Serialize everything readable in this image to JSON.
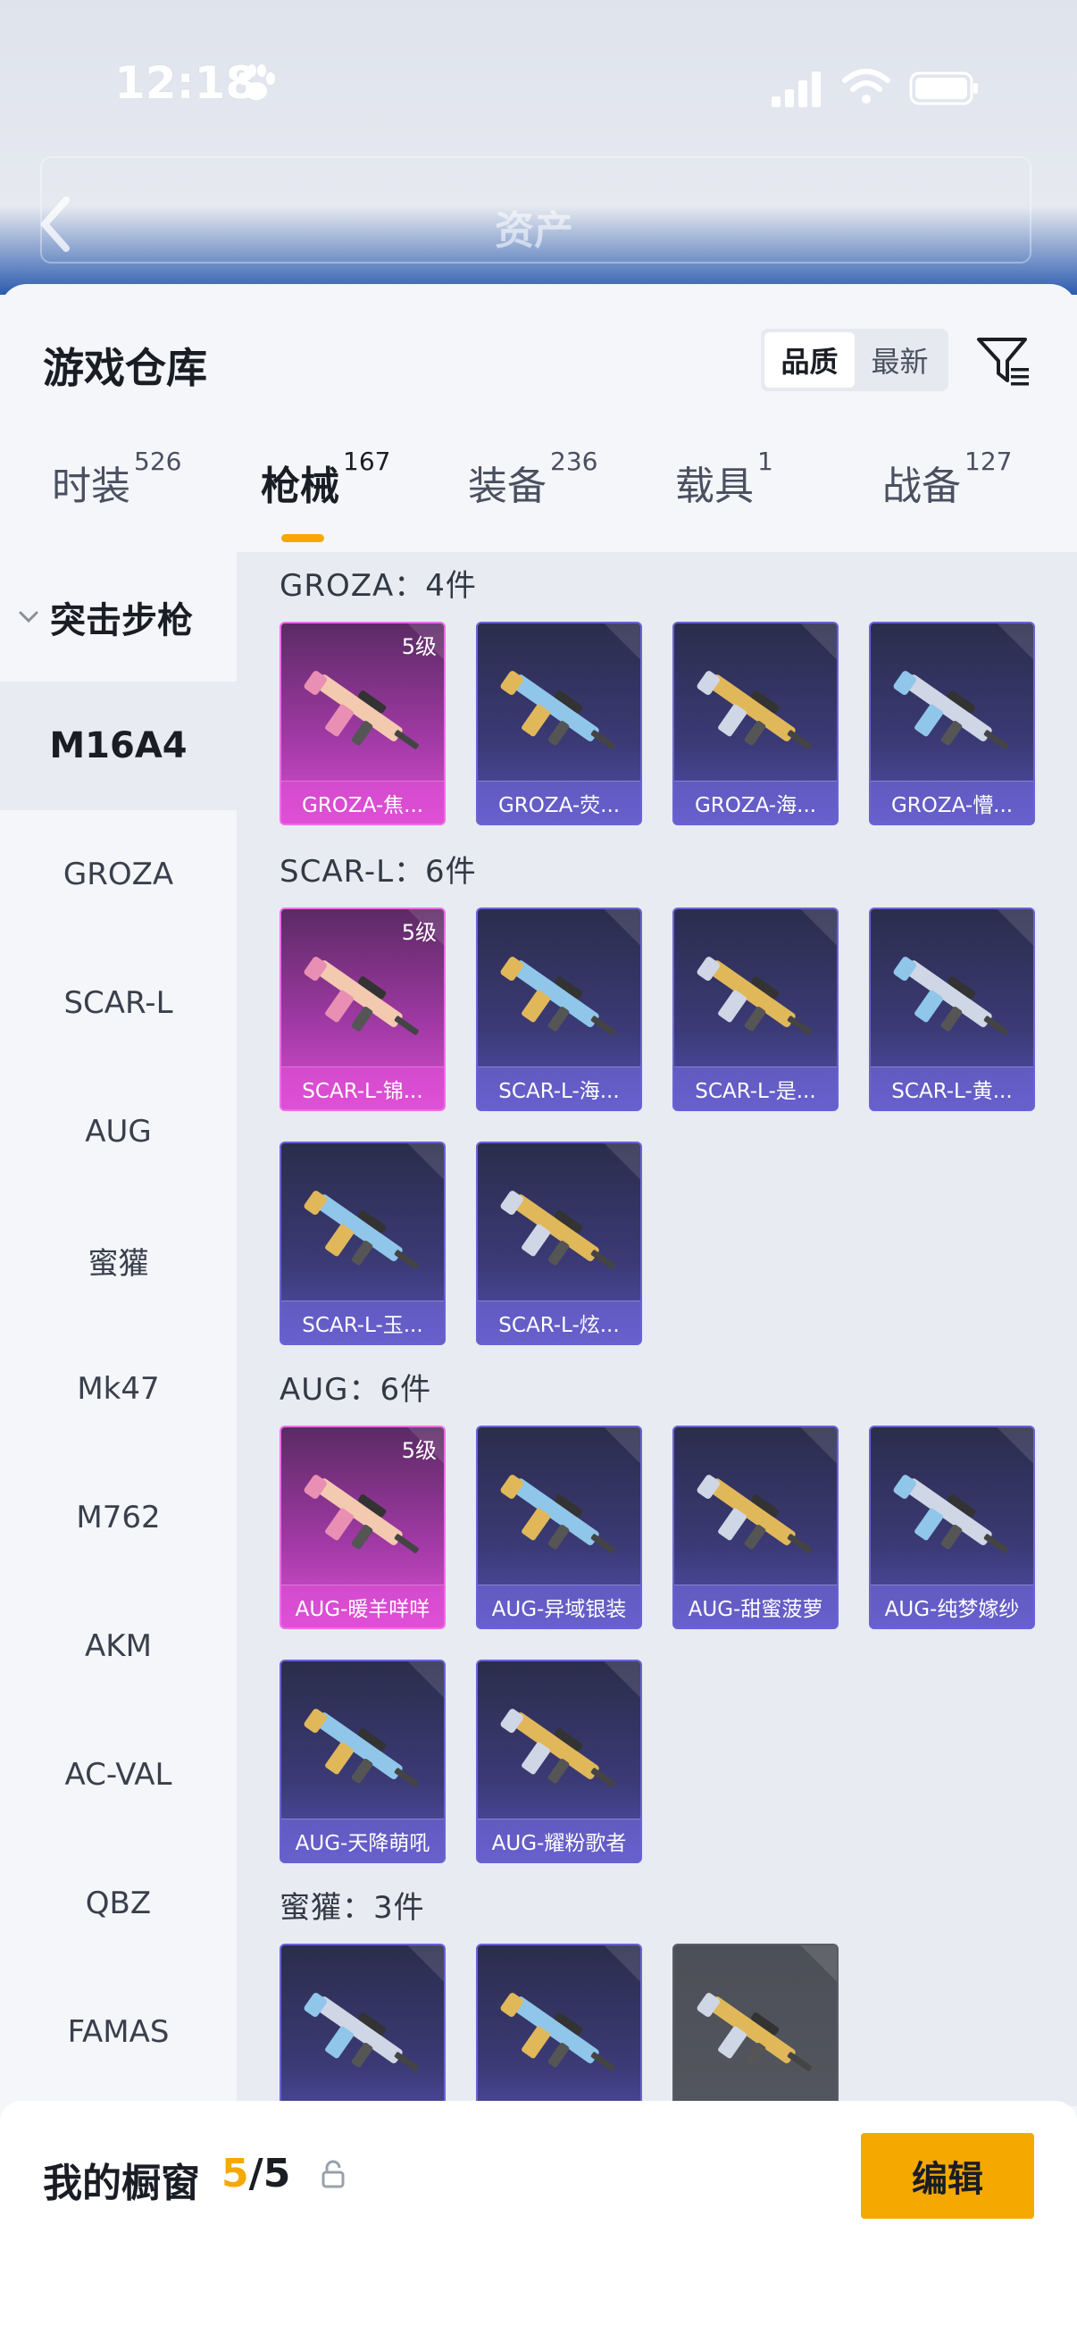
{
  "status_bar": {
    "time": "12:18"
  },
  "background_header": {
    "title": "资产"
  },
  "sheet": {
    "title": "游戏仓库",
    "sort": {
      "options": [
        "品质",
        "最新"
      ],
      "active": "品质"
    }
  },
  "tabs": [
    {
      "label": "时装",
      "count": "526"
    },
    {
      "label": "枪械",
      "count": "167"
    },
    {
      "label": "装备",
      "count": "236"
    },
    {
      "label": "载具",
      "count": "1"
    },
    {
      "label": "战备",
      "count": "127"
    }
  ],
  "active_tab": "枪械",
  "sidebar": {
    "category": "突击步枪",
    "items": [
      "M16A4",
      "GROZA",
      "SCAR-L",
      "AUG",
      "蜜獾",
      "Mk47",
      "M762",
      "AKM",
      "AC-VAL",
      "QBZ",
      "FAMAS"
    ],
    "active": "M16A4"
  },
  "groups": [
    {
      "title": "GROZA：4件",
      "items": [
        {
          "name": "GROZA-焦...",
          "level": "5级",
          "rarity": "legend"
        },
        {
          "name": "GROZA-荧...",
          "rarity": "epic"
        },
        {
          "name": "GROZA-海...",
          "rarity": "epic"
        },
        {
          "name": "GROZA-懵...",
          "rarity": "epic"
        }
      ]
    },
    {
      "title": "SCAR-L：6件",
      "items": [
        {
          "name": "SCAR-L-锦...",
          "level": "5级",
          "rarity": "legend"
        },
        {
          "name": "SCAR-L-海...",
          "rarity": "epic"
        },
        {
          "name": "SCAR-L-是...",
          "rarity": "epic"
        },
        {
          "name": "SCAR-L-黄...",
          "rarity": "epic"
        },
        {
          "name": "SCAR-L-玉...",
          "rarity": "epic"
        },
        {
          "name": "SCAR-L-炫...",
          "rarity": "epic"
        }
      ]
    },
    {
      "title": "AUG：6件",
      "items": [
        {
          "name": "AUG-暖羊咩咩",
          "level": "5级",
          "rarity": "legend"
        },
        {
          "name": "AUG-异域银装",
          "rarity": "epic"
        },
        {
          "name": "AUG-甜蜜菠萝",
          "rarity": "epic"
        },
        {
          "name": "AUG-纯梦嫁纱",
          "rarity": "epic"
        },
        {
          "name": "AUG-天降萌吼",
          "rarity": "epic"
        },
        {
          "name": "AUG-耀粉歌者",
          "rarity": "epic"
        }
      ]
    },
    {
      "title": "蜜獾：3件",
      "items": [
        {
          "name": "",
          "rarity": "epic"
        },
        {
          "name": "",
          "rarity": "epic"
        },
        {
          "name": "",
          "rarity": "grey"
        }
      ]
    }
  ],
  "bottom_bar": {
    "label": "我的橱窗",
    "current": "5",
    "separator": "/",
    "total": "5",
    "edit_label": "编辑"
  },
  "colors": {
    "accent": "#f5a800",
    "legend": "#d850cf",
    "epic": "#5450b0"
  },
  "icons": [
    "paw-icon",
    "signal-icon",
    "wifi-icon",
    "battery-icon",
    "back-icon",
    "filter-icon",
    "chevron-down-icon",
    "gun-icon",
    "share-icon",
    "lock-icon"
  ]
}
